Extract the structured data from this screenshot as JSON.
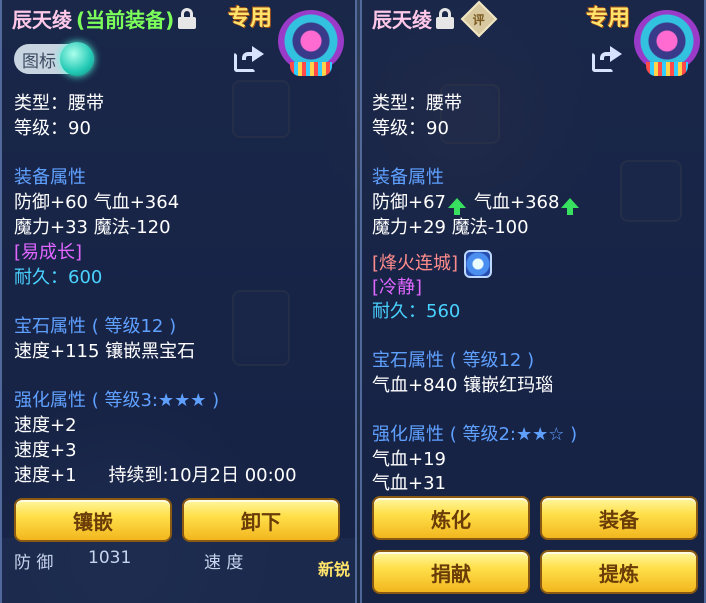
{
  "left_panel": {
    "name": "辰天绫",
    "equipped_tag": "(当前装备)",
    "special_label": "专用",
    "toggle_label": "图标",
    "type_line": "类型：腰带",
    "level_line": "等级：90",
    "equip_attr_head": "装备属性",
    "equip_attr_1": "防御+60 气血+364",
    "equip_attr_2": "魔力+33 魔法-120",
    "special_effect": "[易成长]",
    "durability_label": "耐久：",
    "durability_value": "600",
    "gem_head": "宝石属性 ( 等级12 )",
    "gem_line": "速度+115 镶嵌黑宝石",
    "enhance_head": "强化属性 ( 等级3:★★★ )",
    "enhance_lines": [
      "速度+2",
      "速度+3",
      "速度+1"
    ],
    "enhance_duration": "持续到:10月2日 00:00",
    "buttons": {
      "inlay": "镶嵌",
      "unequip": "卸下"
    },
    "footer_defense": "防 御",
    "footer_defense_value": "1031",
    "footer_speed": "速 度",
    "footer_sharp": "新锐"
  },
  "right_panel": {
    "name": "辰天绫",
    "rate_icon_label": "评",
    "special_label": "专用",
    "type_line": "类型：腰带",
    "level_line": "等级：90",
    "equip_attr_head": "装备属性",
    "equip_attr_1a": "防御+67",
    "equip_attr_1b": "气血+368",
    "equip_attr_2": "魔力+29 魔法-100",
    "special_skill": "[烽火连城]",
    "special_effect": "[冷静]",
    "durability_label": "耐久：",
    "durability_value": "560",
    "gem_head": "宝石属性 ( 等级12 )",
    "gem_line": "气血+840 镶嵌红玛瑙",
    "enhance_head": "强化属性 ( 等级2:★★☆ )",
    "enhance_lines": [
      "气血+19",
      "气血+31"
    ],
    "buttons": {
      "refine": "炼化",
      "equip": "装备",
      "donate": "捐献",
      "extract": "提炼"
    }
  }
}
